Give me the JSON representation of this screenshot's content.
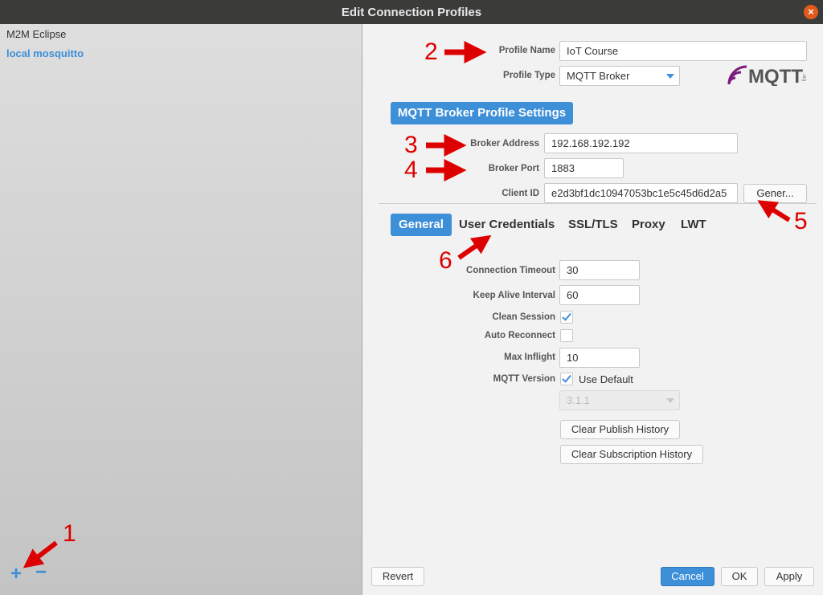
{
  "window": {
    "title": "Edit Connection Profiles",
    "close_glyph": "×"
  },
  "profiles": [
    {
      "label": "M2M Eclipse",
      "selected": false
    },
    {
      "label": "local mosquitto",
      "selected": true
    }
  ],
  "list_actions": {
    "add": "+",
    "remove": "−"
  },
  "profile": {
    "name_label": "Profile Name",
    "name_value": "IoT Course",
    "type_label": "Profile Type",
    "type_value": "MQTT Broker",
    "logo_text": "MQTT",
    "logo_subtext": ".org"
  },
  "broker_section": {
    "header": "MQTT Broker Profile Settings",
    "address_label": "Broker Address",
    "address_value": "192.168.192.192",
    "port_label": "Broker Port",
    "port_value": "1883",
    "client_id_label": "Client ID",
    "client_id_value": "e2d3bf1dc10947053bc1e5c45d6d2a5",
    "generate_label": "Gener..."
  },
  "tabs": [
    {
      "label": "General",
      "active": true
    },
    {
      "label": "User Credentials",
      "active": false
    },
    {
      "label": "SSL/TLS",
      "active": false
    },
    {
      "label": "Proxy",
      "active": false
    },
    {
      "label": "LWT",
      "active": false
    }
  ],
  "general": {
    "connection_timeout_label": "Connection Timeout",
    "connection_timeout_value": "30",
    "keep_alive_label": "Keep Alive Interval",
    "keep_alive_value": "60",
    "clean_session_label": "Clean Session",
    "clean_session_checked": true,
    "auto_reconnect_label": "Auto Reconnect",
    "auto_reconnect_checked": false,
    "max_inflight_label": "Max Inflight",
    "max_inflight_value": "10",
    "mqtt_version_label": "MQTT Version",
    "use_default_label": "Use Default",
    "use_default_checked": true,
    "version_value": "3.1.1",
    "clear_publish_label": "Clear Publish History",
    "clear_subscription_label": "Clear Subscription History"
  },
  "footer": {
    "revert": "Revert",
    "cancel": "Cancel",
    "ok": "OK",
    "apply": "Apply"
  },
  "annotations": [
    "1",
    "2",
    "3",
    "4",
    "5",
    "6"
  ],
  "colors": {
    "accent": "#3d8fd8",
    "annotation": "#dd0000",
    "titlebar": "#3b3b39"
  }
}
